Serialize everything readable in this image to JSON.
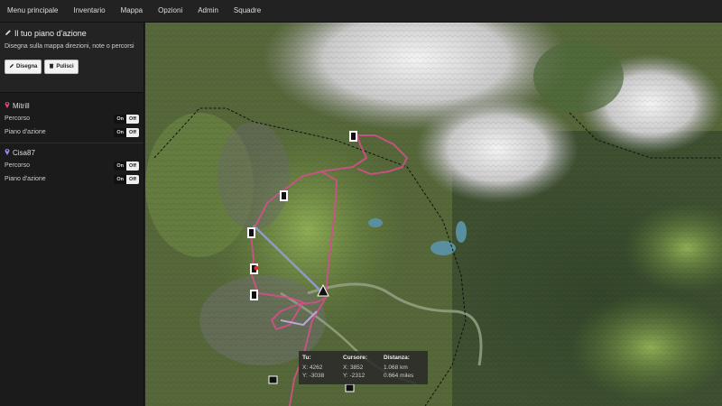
{
  "nav": [
    "Menu principale",
    "Inventario",
    "Mappa",
    "Opzioni",
    "Admin",
    "Squadre"
  ],
  "plan": {
    "title": "Il tuo piano d'azione",
    "subtitle": "Disegna sulla mappa direzioni, note o percorsi",
    "draw_label": "Disegna",
    "clear_label": "Pulisci"
  },
  "users": [
    {
      "name": "Mitrill",
      "pin_color": "#e0447a",
      "rows": [
        {
          "label": "Percorso",
          "on": "On",
          "off": "Off"
        },
        {
          "label": "Piano d'azione",
          "on": "On",
          "off": "Off"
        }
      ]
    },
    {
      "name": "Cisa87",
      "pin_color": "#9a8cff",
      "rows": [
        {
          "label": "Percorso",
          "on": "On",
          "off": "Off"
        },
        {
          "label": "Piano d'azione",
          "on": "On",
          "off": "Off"
        }
      ]
    }
  ],
  "info": {
    "you": {
      "title": "Tu:",
      "x": "X: 4262",
      "y": "Y: -3038"
    },
    "cursor": {
      "title": "Cursore:",
      "x": "X: 3852",
      "y": "Y: -2312"
    },
    "distance": {
      "title": "Distanza:",
      "km": "1.068 km",
      "miles": "0.664 miles"
    }
  },
  "colors": {
    "route": "#d0508a",
    "line": "#8e9ac8"
  }
}
